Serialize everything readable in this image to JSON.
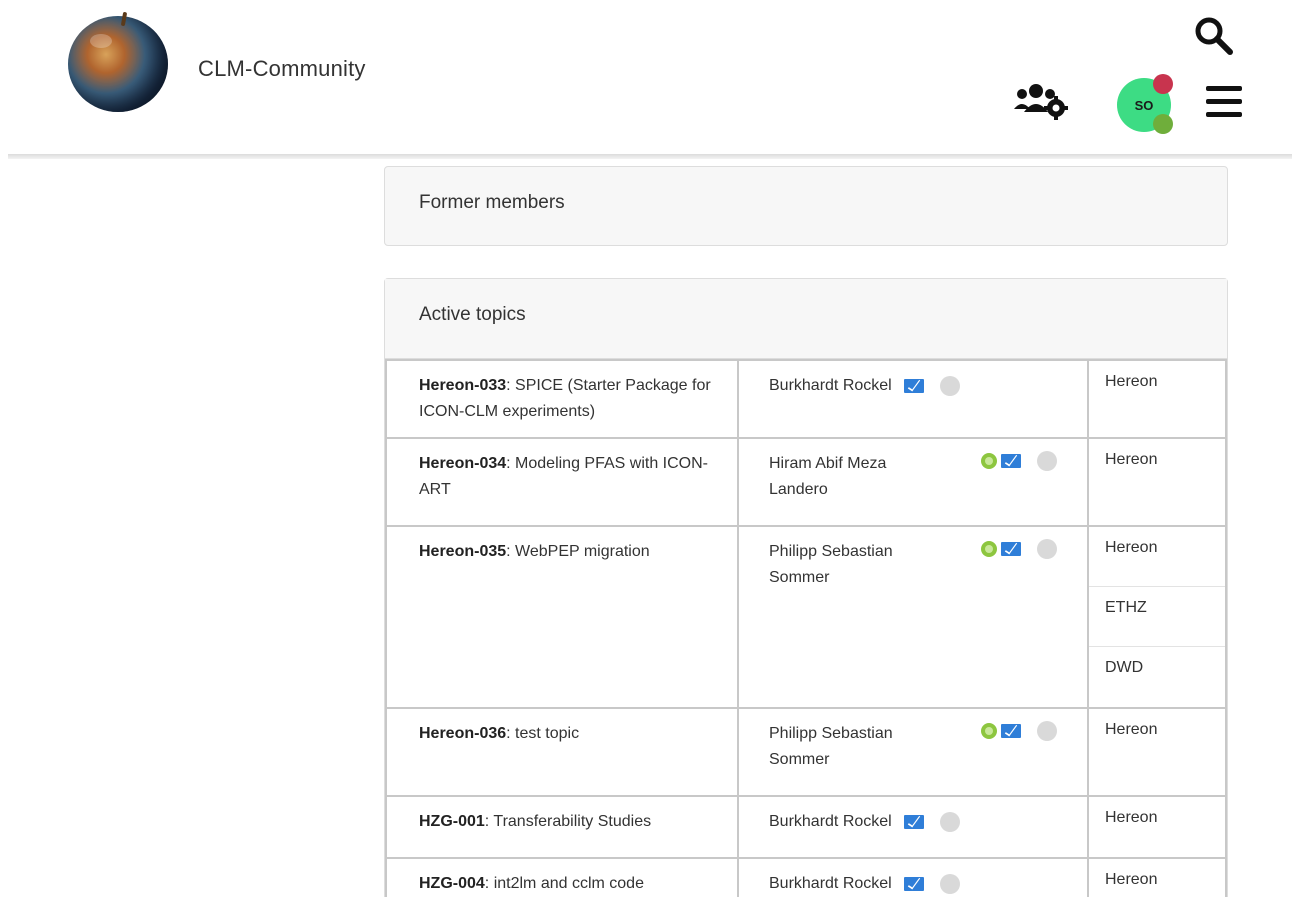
{
  "header": {
    "brand": "CLM-Community",
    "avatar_initials": "SO",
    "icons": [
      "search-icon",
      "users-settings-icon",
      "hamburger-menu-icon"
    ],
    "colors": {
      "avatar": "#3ddc84",
      "notification": "#c8344e",
      "status": "#6fae3b"
    }
  },
  "sections": {
    "former_members": "Former members",
    "active_topics": "Active topics"
  },
  "topics": [
    {
      "code": "Hereon-033",
      "title": ": SPICE (Starter Package for ICON-CLM experiments)",
      "person": "Burkhardt Rockel",
      "orgs": [
        "Hereon"
      ]
    },
    {
      "code": "Hereon-034",
      "title": ": Modeling PFAS with ICON-ART",
      "person": "Hiram Abif Meza Landero",
      "orgs": [
        "Hereon"
      ]
    },
    {
      "code": "Hereon-035",
      "title": ": WebPEP migration",
      "person": "Philipp Sebastian Sommer",
      "orgs": [
        "Hereon",
        "ETHZ",
        "DWD"
      ]
    },
    {
      "code": "Hereon-036",
      "title": ": test topic",
      "person": "Philipp Sebastian Sommer",
      "orgs": [
        "Hereon"
      ]
    },
    {
      "code": "HZG-001",
      "title": ": Transferability Studies",
      "person": "Burkhardt Rockel",
      "orgs": [
        "Hereon"
      ]
    },
    {
      "code": "HZG-004",
      "title": ": int2lm and cclm code",
      "person": "Burkhardt Rockel",
      "orgs": [
        "Hereon"
      ]
    }
  ]
}
